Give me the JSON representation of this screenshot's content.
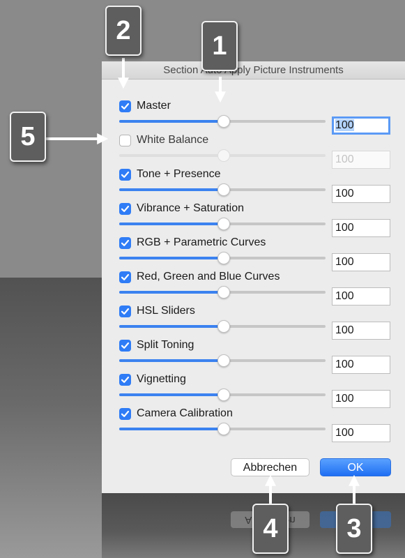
{
  "dialog": {
    "title": "Section Auto Apply Picture Instruments",
    "cancel_label": "Abbrechen",
    "ok_label": "OK"
  },
  "rows": [
    {
      "label": "Master",
      "checked": true,
      "value": "100",
      "slider_value": 50
    },
    {
      "label": "White Balance",
      "checked": false,
      "value": "100",
      "slider_value": 50
    },
    {
      "label": "Tone + Presence",
      "checked": true,
      "value": "100",
      "slider_value": 50
    },
    {
      "label": "Vibrance + Saturation",
      "checked": true,
      "value": "100",
      "slider_value": 50
    },
    {
      "label": "RGB + Parametric Curves",
      "checked": true,
      "value": "100",
      "slider_value": 50
    },
    {
      "label": "Red, Green and Blue Curves",
      "checked": true,
      "value": "100",
      "slider_value": 50
    },
    {
      "label": "HSL Sliders",
      "checked": true,
      "value": "100",
      "slider_value": 50
    },
    {
      "label": "Split Toning",
      "checked": true,
      "value": "100",
      "slider_value": 50
    },
    {
      "label": "Vignetting",
      "checked": true,
      "value": "100",
      "slider_value": 50
    },
    {
      "label": "Camera Calibration",
      "checked": true,
      "value": "100",
      "slider_value": 50
    }
  ],
  "callouts": [
    "1",
    "2",
    "3",
    "4",
    "5"
  ],
  "colors": {
    "accent": "#2f7cf6",
    "callout_bg": "#5e5e5e"
  }
}
